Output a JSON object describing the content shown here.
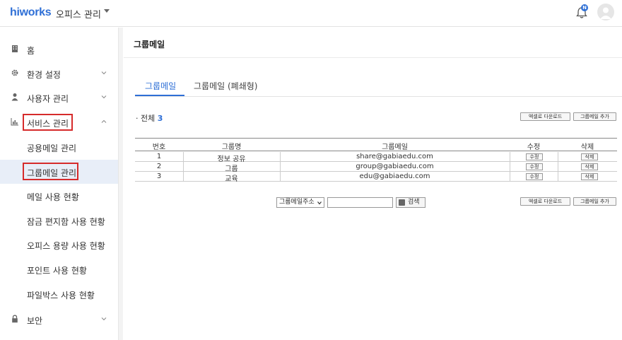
{
  "header": {
    "logo": "hiworks",
    "app_name": "오피스 관리",
    "notification_badge": "N"
  },
  "sidebar": {
    "items": [
      {
        "label": "홈",
        "icon": "building-icon"
      },
      {
        "label": "환경 설정",
        "icon": "gear-icon"
      },
      {
        "label": "사용자 관리",
        "icon": "user-icon"
      },
      {
        "label": "서비스 관리",
        "icon": "chart-icon"
      }
    ],
    "sub_items": [
      {
        "label": "공용메일 관리"
      },
      {
        "label": "그룹메일 관리"
      },
      {
        "label": "메일 사용 현황"
      },
      {
        "label": "잠금 편지함 사용 현황"
      },
      {
        "label": "오피스 용량 사용 현황"
      },
      {
        "label": "포인트 사용 현황"
      },
      {
        "label": "파일박스 사용 현황"
      }
    ],
    "security": {
      "label": "보안",
      "icon": "lock-icon"
    }
  },
  "main": {
    "title": "그룹메일",
    "tabs": [
      {
        "label": "그룹메일"
      },
      {
        "label": "그룹메일 (폐쇄형)"
      }
    ],
    "total_label": "· 전체",
    "total_count": "3",
    "excel_download": "엑셀로 다운로드",
    "add_group_mail": "그룹메일 추가",
    "table": {
      "headers": [
        "번호",
        "그룹명",
        "그룹메일",
        "수정",
        "삭제"
      ],
      "rows": [
        {
          "no": "1",
          "name": "정보 공유",
          "email": "share@gabiaedu.com",
          "edit": "수정",
          "delete": "삭제"
        },
        {
          "no": "2",
          "name": "그룹",
          "email": "group@gabiaedu.com",
          "edit": "수정",
          "delete": "삭제"
        },
        {
          "no": "3",
          "name": "교육",
          "email": "edu@gabiaedu.com",
          "edit": "수정",
          "delete": "삭제"
        }
      ]
    },
    "search": {
      "select_value": "그룹메일주소",
      "input_value": "",
      "button_label": "검색"
    }
  },
  "colors": {
    "accent": "#2e6fd6",
    "highlight_box": "#d62b2b",
    "active_bg": "#e8eef8"
  }
}
